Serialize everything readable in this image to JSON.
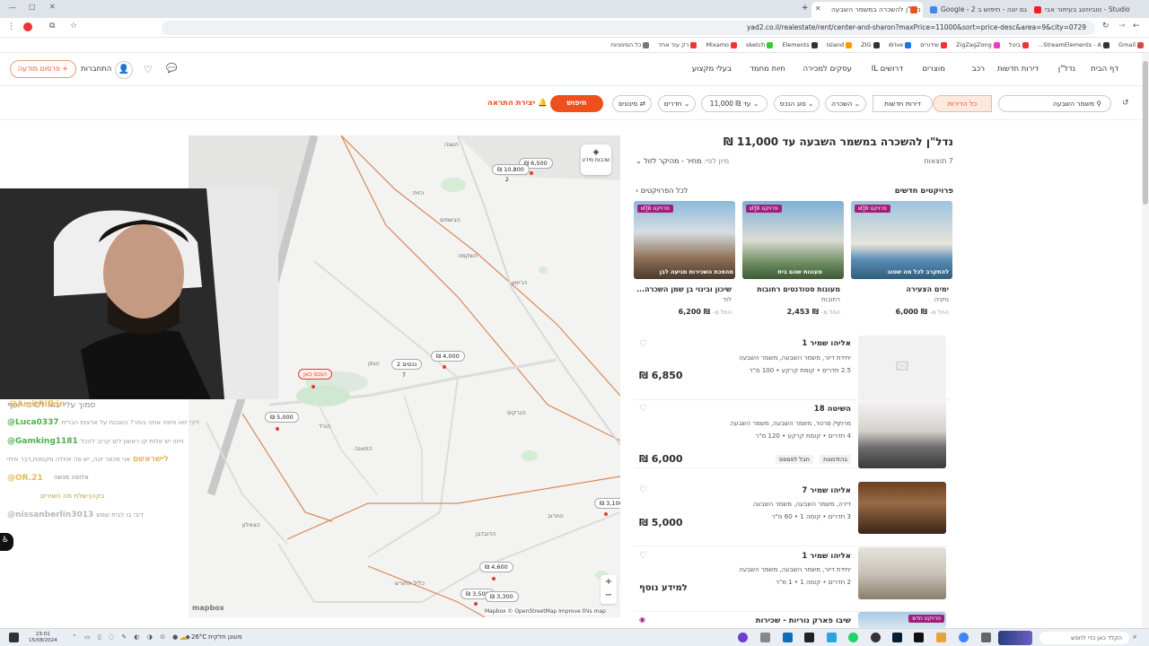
{
  "browser": {
    "tabs": [
      {
        "label": "טוביוזונג בעיתור אבי - Studio"
      },
      {
        "label": "Google - 2 גם יונה - חיפוש ב"
      },
      {
        "label": "נדל\"ן להשכרה במשמר השבעה",
        "active": true
      }
    ],
    "url": "yad2.co.il/realestate/rent/center-and-sharon?maxPrice=11000&sort=price-desc&area=9&city=0729",
    "bookmarks": [
      "Gmail",
      "StreamElements - A...",
      "ביטל",
      "ZigZagZong",
      "שידורים",
      "drive",
      "ZIG",
      "Island",
      "Elements",
      "sketch",
      "Mixamo",
      "רק עוד אחד",
      "כל הסימניות"
    ]
  },
  "site": {
    "nav": [
      "דף הבית",
      "נדל\"ן",
      "דירות חדשות",
      "רכב",
      "מוצרים",
      "דרושים IL",
      "עסקים למכירה",
      "חיות מחמד",
      "בעלי מקצוע"
    ],
    "post_label": "+ פרסום מודעה",
    "connect_label": "התחברות"
  },
  "filters": {
    "city_input": "משמר השבעה",
    "all_dwellings": "כל הדירות",
    "new_dwellings": "דירות חדשות",
    "deal": "השכרה",
    "property_type": "סוג הנכס",
    "price": "עד ₪ 11,000",
    "rooms": "חדרים",
    "more_filters": "סינונים",
    "search": "חיפוש",
    "create_alert": "יצירת התראה"
  },
  "map": {
    "layers_label": "שכבות מידע",
    "price_pins": [
      "₪ 6,500",
      "₪ 10,800",
      "₪ 4,000",
      "2 נכסים",
      "₪ 5,000",
      "₪ 3,100",
      "₪ 4,600",
      "₪ 3,500",
      "₪ 3,300"
    ],
    "pin_counts": [
      "2",
      "7"
    ],
    "selected_pin": "הנכס כאן",
    "streets": [
      "השנה",
      "הזית",
      "השקמה",
      "הרימון",
      "הגפן",
      "הורד",
      "התאנה",
      "הנרקיס",
      "החרוב",
      "הדובדבן",
      "הבשמים",
      "הצאלון",
      "כליל החורש"
    ],
    "attribution": "Mapbox © OpenStreetMap  Improve this map",
    "logo": "mapbox",
    "zoom_in": "+",
    "zoom_out": "−"
  },
  "chat": [
    {
      "user": "",
      "text": "סמוך עליי בוא לכרמי יוסף",
      "color": "#ddd"
    },
    {
      "user": "@AmitRifkin",
      "text": "",
      "color": "#e6b85c"
    },
    {
      "user": "@Luca0337",
      "text": "דיבי יואו איפה אתה בוחר? השבנת על ארצות הברית",
      "color": "#4caf50"
    },
    {
      "user": "@Gamking1181",
      "text": "חיוה יש זולות קו ראשון לים קרוב להכל",
      "color": "#4caf50"
    },
    {
      "user": "לישראשם",
      "text": "אני מכפר יונה, יש פה אחלה מקומות,דבר איתי",
      "color": "#e6b85c"
    },
    {
      "user": "",
      "text": "אלופה מנשה",
      "color": "#ddd"
    },
    {
      "user": "@OR.21",
      "text": "",
      "color": "#e6b85c"
    },
    {
      "user": "",
      "text": "בקהן-שלת מה השירים",
      "color": "#ddd"
    },
    {
      "user": "@nissanberlin3013",
      "text": "דיבי בו לבית שמש",
      "color": "#ccc"
    }
  ],
  "results": {
    "title": "נדל\"ן להשכרה במשמר השבעה עד 11,000 ₪",
    "count": "7 תוצאות",
    "sort_label": "מיון לפי:",
    "sort_value": "מחיר - מהיקר לזול",
    "projects_heading": "פרויקטים חדשים",
    "all_projects": "לכל הפרויקטים",
    "new_project_badge": "פרויקט חדש",
    "projects": [
      {
        "name": "ימים הצעירה",
        "city": "נתניה",
        "price": "₪ 6,000",
        "from": "החל מ-",
        "caption": "להתקרב לכל מה שטוב"
      },
      {
        "name": "מעונות סטודנטים רחובות",
        "city": "רחובות",
        "price": "₪ 2,453",
        "from": "החל מ-",
        "caption": "מעונות שהם בית"
      },
      {
        "name": "שיכון ובינוי בן שמן השכרה...",
        "city": "לוד",
        "price": "₪ 6,200",
        "from": "החל מ-",
        "caption": "מהפכת השכירות מגיעה לבן"
      }
    ],
    "listings": [
      {
        "title": "אליהו שמיר 1",
        "sub": "יחידת דיור, משמר השבעה, משמר השבעה",
        "details": "2.5 חדרים • קומת קרקע • 100 מ\"ר",
        "price": "₪ 6,850",
        "tags": []
      },
      {
        "title": "השיטה 18",
        "sub": "מרתף/ פרטר, משמר השבעה, משמר השבעה",
        "details": "4 חדרים • קומת קרקע • 120 מ\"ר",
        "price": "₪ 6,000",
        "tags": [
          "בהזדמנות",
          "חבל לפספס"
        ]
      },
      {
        "title": "אליהו שמיר 7",
        "sub": "דירה, משמר השבעה, משמר השבעה",
        "details": "3 חדרים • קומה 1 • 60 מ\"ר",
        "price": "₪ 5,000",
        "tags": []
      },
      {
        "title": "אליהו שמיר 1",
        "sub": "יחידת דיור, משמר השבעה, משמר השבעה",
        "details": "2 חדרים • קומה 1 • 1 מ\"ר",
        "price": "למידע נוסף",
        "tags": []
      },
      {
        "title": "שיבו פארק נוריות - שכירות",
        "sub": "",
        "details": "",
        "price": "",
        "tags": []
      }
    ]
  },
  "taskbar": {
    "search_placeholder": "הקלד כאן כדי לחפש",
    "weather": "26°C",
    "weather_desc": "מעונן חלקית",
    "time": "23:01",
    "date": "15/08/2024"
  },
  "colors": {
    "accent": "#ee4f1c",
    "badge": "#a01f7b",
    "road": "#d88a5a"
  }
}
